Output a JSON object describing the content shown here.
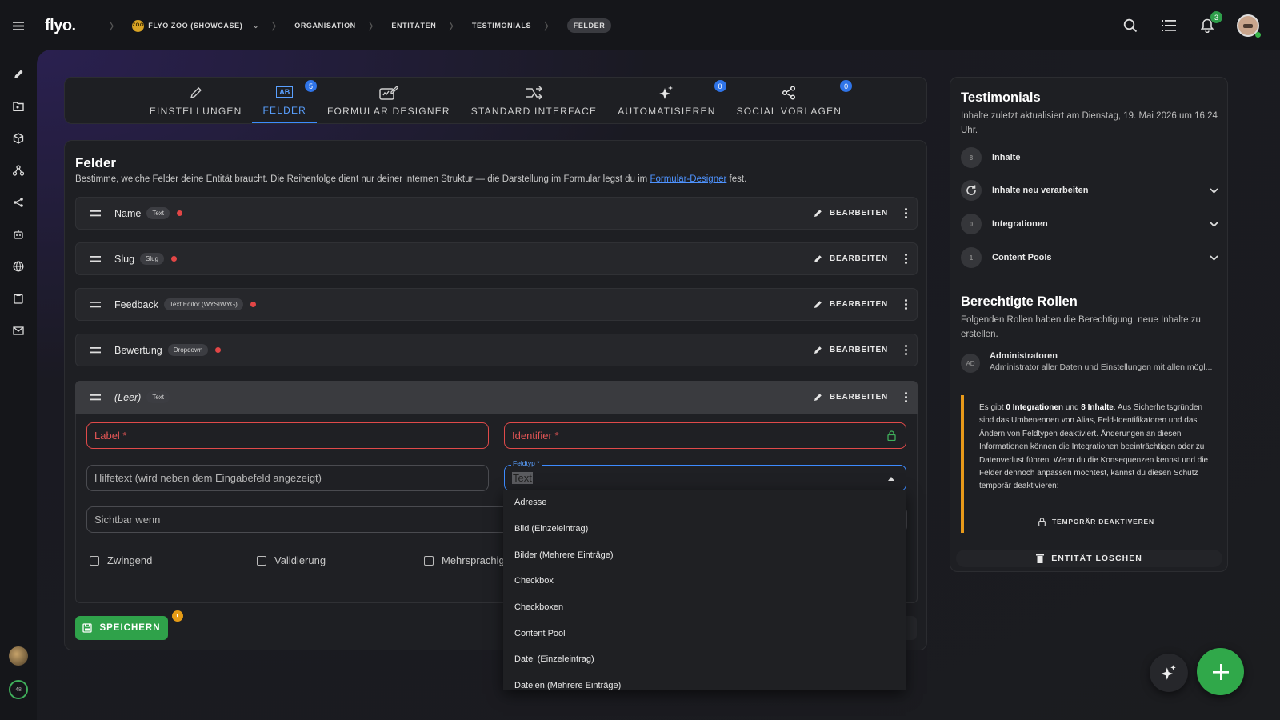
{
  "app": {
    "logo": "flyo."
  },
  "breadcrumb": {
    "workspace_badge": "ZOO",
    "workspace": "FLYO ZOO (SHOWCASE)",
    "items": [
      "ORGANISATION",
      "ENTITÄTEN",
      "TESTIMONIALS",
      "FELDER"
    ]
  },
  "header": {
    "notifications_count": "3"
  },
  "tabs": [
    {
      "label": "EINSTELLUNGEN",
      "icon": "pencil-icon"
    },
    {
      "label": "FELDER",
      "icon": "ab-icon",
      "badge": "5",
      "active": true
    },
    {
      "label": "FORMULAR DESIGNER",
      "icon": "form-edit-icon"
    },
    {
      "label": "STANDARD INTERFACE",
      "icon": "interface-icon"
    },
    {
      "label": "AUTOMATISIEREN",
      "icon": "sparkle-icon",
      "badge": "0"
    },
    {
      "label": "SOCIAL VORLAGEN",
      "icon": "share-icon",
      "badge": "0"
    }
  ],
  "fields": {
    "title": "Felder",
    "description": "Bestimme, welche Felder deine Entität braucht. Die Reihenfolge dient nur deiner internen Struktur — die Darstellung im Formular legst du im",
    "description_link": "Formular-Designer",
    "description_end": "fest.",
    "edit_label": "BEARBEITEN",
    "rows": [
      {
        "name": "Name",
        "type": "Text",
        "required": true
      },
      {
        "name": "Slug",
        "type": "Slug",
        "required": true
      },
      {
        "name": "Feedback",
        "type": "Text Editor (WYSIWYG)",
        "required": true
      },
      {
        "name": "Bewertung",
        "type": "Dropdown",
        "required": true
      }
    ],
    "expanded": {
      "name": "(Leer)",
      "type": "Text",
      "label_placeholder": "Label *",
      "identifier_placeholder": "Identifier *",
      "helptext_placeholder": "Hilfetext (wird neben dem Eingabefeld angezeigt)",
      "fieldtype_label": "Feldtyp *",
      "fieldtype_value": "Text",
      "visible_when_placeholder": "Sichtbar wenn",
      "checkboxes": [
        "Zwingend",
        "Validierung",
        "Mehrsprachig"
      ]
    },
    "save_label": "SPEICHERN",
    "save_warning": "!"
  },
  "dropdown": {
    "options": [
      "Adresse",
      "Bild (Einzeleintrag)",
      "Bilder (Mehrere Einträge)",
      "Checkbox",
      "Checkboxen",
      "Content Pool",
      "Datei (Einzeleintrag)",
      "Dateien (Mehrere Einträge)"
    ]
  },
  "side": {
    "title": "Testimonials",
    "updated": "Inhalte zuletzt aktualisiert am Dienstag, 19. Mai 2026 um 16:24 Uhr.",
    "stats": [
      {
        "count": "8",
        "label": "Inhalte"
      },
      {
        "count": "",
        "label": "Inhalte neu verarbeiten"
      },
      {
        "count": "0",
        "label": "Integrationen"
      },
      {
        "count": "1",
        "label": "Content Pools"
      }
    ],
    "roles_title": "Berechtigte Rollen",
    "roles_desc": "Folgenden Rollen haben die Berechtigung, neue Inhalte zu erstellen.",
    "role": {
      "initials": "AD",
      "name": "Administratoren",
      "desc": "Administrator aller Daten und Einstellungen mit allen mögl..."
    },
    "warning": {
      "p1": "Es gibt ",
      "b1": "0 Integrationen",
      "p2": " und ",
      "b2": "8 Inhalte",
      "p3": ". Aus Sicherheitsgründen sind das Umbenennen von Alias, Feld-Identifikatoren und das Ändern von Feldtypen deaktiviert. Änderungen an diesen Informationen können die Integrationen beeinträchtigen oder zu Datenverlust führen. Wenn du die Konsequenzen kennst und die Felder dennoch anpassen möchtest, kannst du diesen Schutz temporär deaktivieren:",
      "action": "TEMPORÄR DEAKTIVEREN"
    },
    "delete_label": "ENTITÄT LÖSCHEN"
  },
  "rail": {
    "progress": "48"
  },
  "colors": {
    "accent": "#3d8bff",
    "success": "#30a84a",
    "error": "#e24646",
    "warning": "#e89a1a"
  }
}
